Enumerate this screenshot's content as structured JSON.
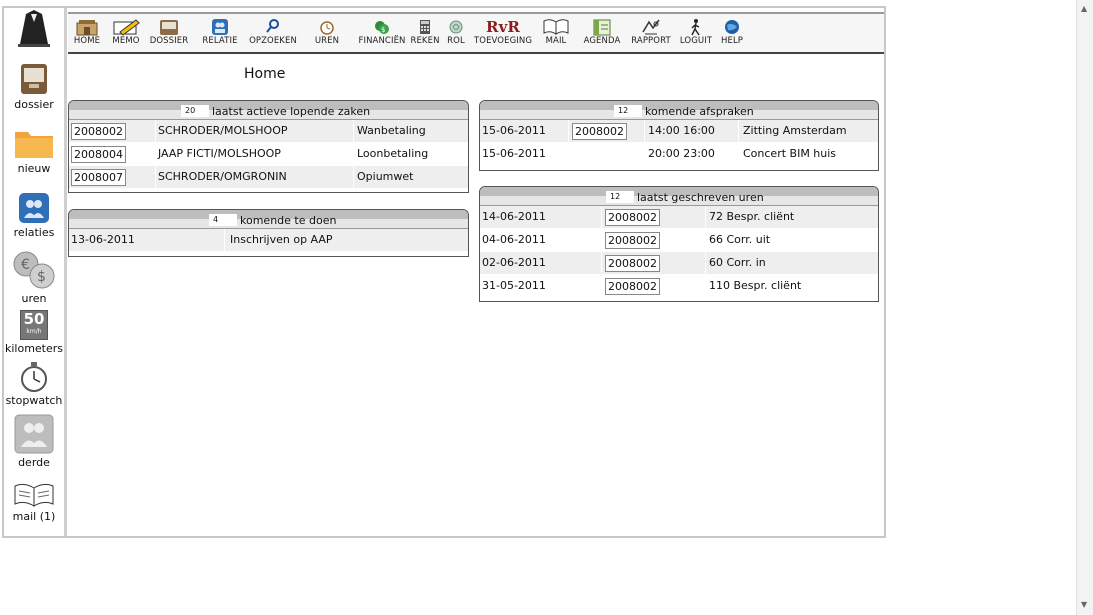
{
  "page": {
    "title": "Home"
  },
  "sidebar": {
    "items": [
      {
        "label": "dossier",
        "icon": "dossier-icon"
      },
      {
        "label": "nieuw",
        "icon": "folder-icon"
      },
      {
        "label": "relaties",
        "icon": "relations-icon"
      },
      {
        "label": "uren",
        "icon": "money-icon"
      },
      {
        "label": "kilometers",
        "icon": "speed-sign-icon",
        "sign_number": "50",
        "sign_unit": "km/h"
      },
      {
        "label": "stopwatch",
        "icon": "stopwatch-icon"
      },
      {
        "label": "derde",
        "icon": "third-party-icon"
      },
      {
        "label": "mail (1)",
        "icon": "open-book-icon"
      }
    ]
  },
  "toolbar": {
    "items": [
      {
        "label": "HOME",
        "icon": "home-icon"
      },
      {
        "label": "MEMO",
        "icon": "memo-icon"
      },
      {
        "label": "DOSSIER",
        "icon": "dossier-icon"
      },
      {
        "label": "RELATIE",
        "icon": "relatie-icon"
      },
      {
        "label": "OPZOEKEN",
        "icon": "search-icon"
      },
      {
        "label": "UREN",
        "icon": "clock-icon"
      },
      {
        "label": "FINANCIËN",
        "icon": "finance-icon"
      },
      {
        "label": "REKEN",
        "icon": "calculator-icon"
      },
      {
        "label": "ROL",
        "icon": "rol-icon"
      },
      {
        "label": "TOEVOEGING",
        "icon": "rvr-logo-icon",
        "logo_text": "RvR"
      },
      {
        "label": "MAIL",
        "icon": "mail-icon"
      },
      {
        "label": "AGENDA",
        "icon": "agenda-icon"
      },
      {
        "label": "RAPPORT",
        "icon": "report-icon"
      },
      {
        "label": "LOGUIT",
        "icon": "logout-icon"
      },
      {
        "label": "HELP",
        "icon": "help-icon"
      }
    ]
  },
  "panels": {
    "zaken": {
      "count": "20",
      "title": "laatst actieve lopende zaken",
      "rows": [
        {
          "nr": "2008002",
          "name": "SCHRODER/MOLSHOOP",
          "subject": "Wanbetaling"
        },
        {
          "nr": "2008004",
          "name": "JAAP FICTI/MOLSHOOP",
          "subject": "Loonbetaling"
        },
        {
          "nr": "2008007",
          "name": "SCHRODER/OMGRONIN",
          "subject": "Opiumwet"
        }
      ]
    },
    "todo": {
      "count": "4",
      "title": "komende te doen",
      "rows": [
        {
          "date": "13-06-2011",
          "text": "Inschrijven op AAP"
        }
      ]
    },
    "afspraken": {
      "count": "12",
      "title": "komende afspraken",
      "rows": [
        {
          "date": "15-06-2011",
          "nr": "2008002",
          "time": "14:00 16:00",
          "desc": "Zitting Amsterdam"
        },
        {
          "date": "15-06-2011",
          "nr": "",
          "time": "20:00 23:00",
          "desc": "Concert BIM huis"
        }
      ]
    },
    "uren": {
      "count": "12",
      "title": "laatst geschreven uren",
      "rows": [
        {
          "date": "14-06-2011",
          "nr": "2008002",
          "desc": "72 Bespr. cliënt"
        },
        {
          "date": "04-06-2011",
          "nr": "2008002",
          "desc": "66 Corr. uit"
        },
        {
          "date": "02-06-2011",
          "nr": "2008002",
          "desc": "60 Corr. in"
        },
        {
          "date": "31-05-2011",
          "nr": "2008002",
          "desc": "110 Bespr. cliënt"
        }
      ]
    }
  }
}
